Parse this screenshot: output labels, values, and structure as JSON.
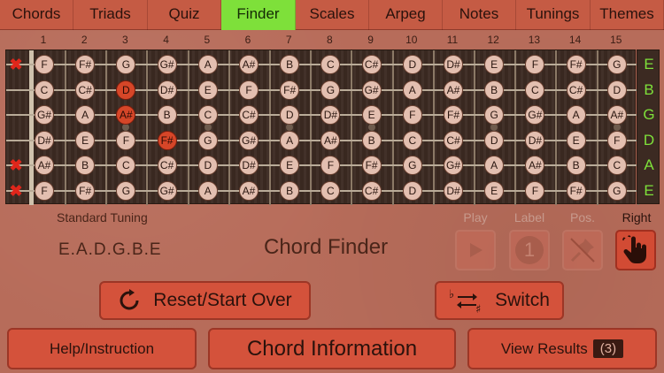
{
  "nav": {
    "tabs": [
      "Chords",
      "Triads",
      "Quiz",
      "Finder",
      "Scales",
      "Arpeg",
      "Notes",
      "Tunings",
      "Themes"
    ],
    "active_index": 3
  },
  "fretboard": {
    "fret_numbers": [
      "1",
      "2",
      "3",
      "4",
      "5",
      "6",
      "7",
      "8",
      "9",
      "10",
      "11",
      "12",
      "13",
      "14",
      "15"
    ],
    "open_strings": [
      "E",
      "B",
      "G",
      "D",
      "A",
      "E"
    ],
    "muted_strings": [
      0,
      4,
      5
    ],
    "strings": [
      [
        "F",
        "F#",
        "G",
        "G#",
        "A",
        "A#",
        "B",
        "C",
        "C#",
        "D",
        "D#",
        "E",
        "F",
        "F#",
        "G"
      ],
      [
        "C",
        "C#",
        "D",
        "D#",
        "E",
        "F",
        "F#",
        "G",
        "G#",
        "A",
        "A#",
        "B",
        "C",
        "C#",
        "D"
      ],
      [
        "G#",
        "A",
        "A#",
        "B",
        "C",
        "C#",
        "D",
        "D#",
        "E",
        "F",
        "F#",
        "G",
        "G#",
        "A",
        "A#"
      ],
      [
        "D#",
        "E",
        "F",
        "F#",
        "G",
        "G#",
        "A",
        "A#",
        "B",
        "C",
        "C#",
        "D",
        "D#",
        "E",
        "F"
      ],
      [
        "A#",
        "B",
        "C",
        "C#",
        "D",
        "D#",
        "E",
        "F",
        "F#",
        "G",
        "G#",
        "A",
        "A#",
        "B",
        "C"
      ],
      [
        "F",
        "F#",
        "G",
        "G#",
        "A",
        "A#",
        "B",
        "C",
        "C#",
        "D",
        "D#",
        "E",
        "F",
        "F#",
        "G"
      ]
    ],
    "highlighted": [
      [
        1,
        2
      ],
      [
        2,
        2
      ],
      [
        3,
        3
      ]
    ],
    "inlay_frets": [
      3,
      5,
      7,
      9,
      12,
      15
    ]
  },
  "tuning": {
    "title": "Standard Tuning",
    "value": "E.A.D.G.B.E"
  },
  "finder_title": "Chord Finder",
  "controls": {
    "play_label": "Play",
    "label_label": "Label",
    "pos_label": "Pos.",
    "right_label": "Right",
    "label_number": "1"
  },
  "buttons": {
    "reset": "Reset/Start Over",
    "switch": "Switch",
    "help": "Help/Instruction",
    "chord_info": "Chord Information",
    "view_results": "View Results",
    "results_count": "(3)"
  },
  "colors": {
    "accent_green": "#7ee03a",
    "highlight_red": "#d64628",
    "mute_red": "#e0261b"
  }
}
